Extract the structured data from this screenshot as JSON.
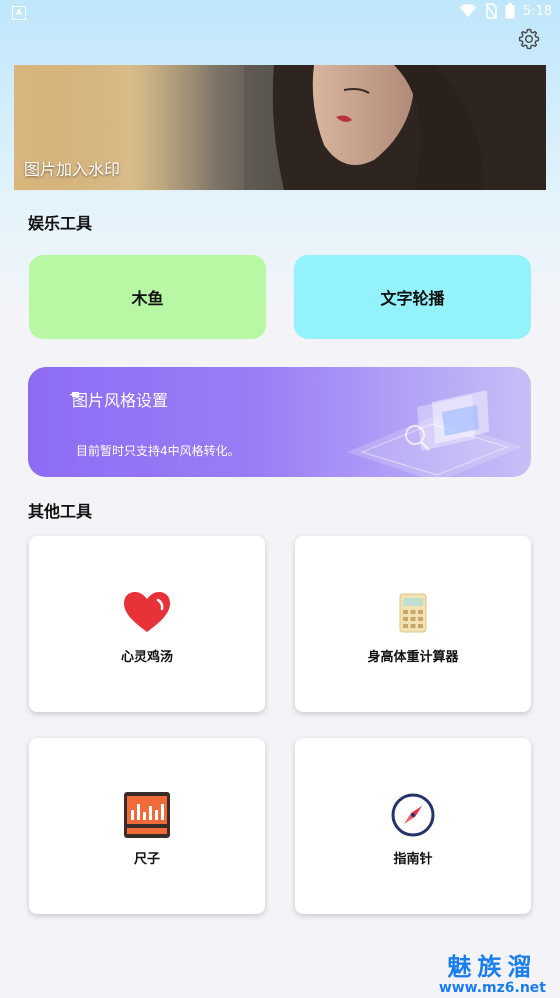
{
  "status_bar": {
    "time": "5:18",
    "notification_icon": "A"
  },
  "header": {
    "settings_icon": "gear-icon"
  },
  "banner": {
    "label": "图片加入水印"
  },
  "entertainment": {
    "title": "娱乐工具",
    "items": [
      {
        "label": "木鱼",
        "color": "#b8f7a3"
      },
      {
        "label": "文字轮播",
        "color": "#93f2fc"
      }
    ]
  },
  "style_card": {
    "title": "图片风格设置",
    "description": "目前暂时只支持4中风格转化。"
  },
  "other_tools": {
    "title": "其他工具",
    "items": [
      {
        "label": "心灵鸡汤",
        "icon": "heart-icon"
      },
      {
        "label": "身高体重计算器",
        "icon": "calculator-icon"
      },
      {
        "label": "尺子",
        "icon": "ruler-icon"
      },
      {
        "label": "指南针",
        "icon": "compass-icon"
      }
    ]
  },
  "watermark": {
    "brand": "魅族溜",
    "url": "www.mz6.net"
  }
}
